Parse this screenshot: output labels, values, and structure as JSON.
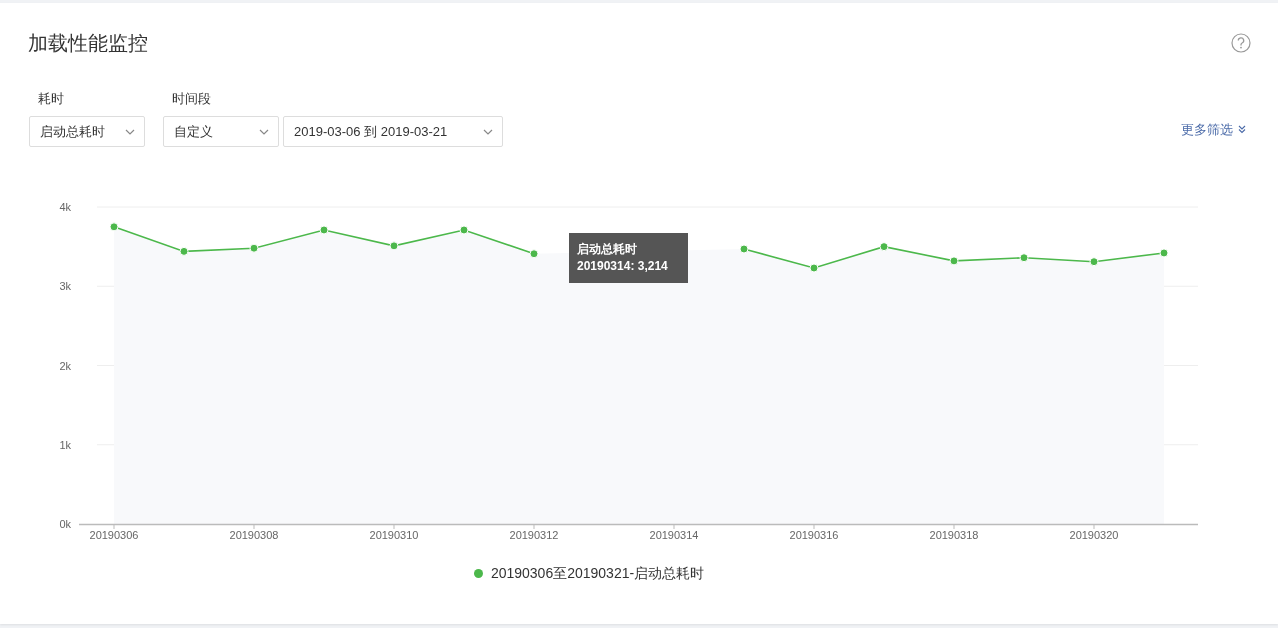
{
  "title": "加载性能监控",
  "filters": [
    {
      "label": "耗时",
      "value": "启动总耗时"
    },
    {
      "label": "时间段",
      "value": "自定义"
    }
  ],
  "date_range": {
    "value": "2019-03-06 到 2019-03-21"
  },
  "more_filters": "更多筛选",
  "chart_data": {
    "type": "line",
    "grid": true,
    "categories": [
      "20190306",
      null,
      "20190308",
      null,
      "20190310",
      null,
      "20190312",
      null,
      "20190314",
      null,
      "20190316",
      null,
      "20190318",
      null,
      "20190320",
      null
    ],
    "series": [
      {
        "name": "20190306至20190321-启动总耗时",
        "color": "#4cb84b",
        "marker": true,
        "values": [
          3750,
          3440,
          3480,
          3710,
          3510,
          3710,
          3410,
          null,
          null,
          3470,
          3230,
          3500,
          3320,
          3360,
          3310,
          3420
        ]
      }
    ],
    "ylim": [
      0,
      4000
    ],
    "yticks": [
      {
        "value": 0,
        "label": "0k"
      },
      {
        "value": 1000,
        "label": "1k"
      },
      {
        "value": 2000,
        "label": "2k"
      },
      {
        "value": 3000,
        "label": "3k"
      },
      {
        "value": 4000,
        "label": "4k"
      }
    ]
  },
  "tooltip": {
    "title": "启动总耗时",
    "text": "20190314: 3,214"
  }
}
